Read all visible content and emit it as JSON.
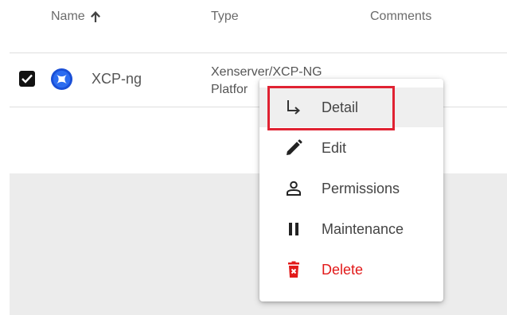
{
  "table": {
    "columns": {
      "name": "Name",
      "type": "Type",
      "comments": "Comments"
    },
    "rows": [
      {
        "name": "XCP-ng",
        "type_line1": "Xenserver/XCP-NG",
        "type_line2": "Platfor",
        "checked": true
      }
    ]
  },
  "context_menu": {
    "items": [
      {
        "label": "Detail",
        "icon": "subdirectory-arrow-right-icon"
      },
      {
        "label": "Edit",
        "icon": "pencil-icon"
      },
      {
        "label": "Permissions",
        "icon": "person-icon"
      },
      {
        "label": "Maintenance",
        "icon": "pause-icon"
      },
      {
        "label": "Delete",
        "icon": "trash-icon"
      }
    ],
    "highlighted_item": "Detail"
  },
  "colors": {
    "delete": "#e21a1a",
    "highlight_border": "#e02232",
    "logo_blue": "#1a4fd6",
    "empty_area": "#ececec"
  }
}
